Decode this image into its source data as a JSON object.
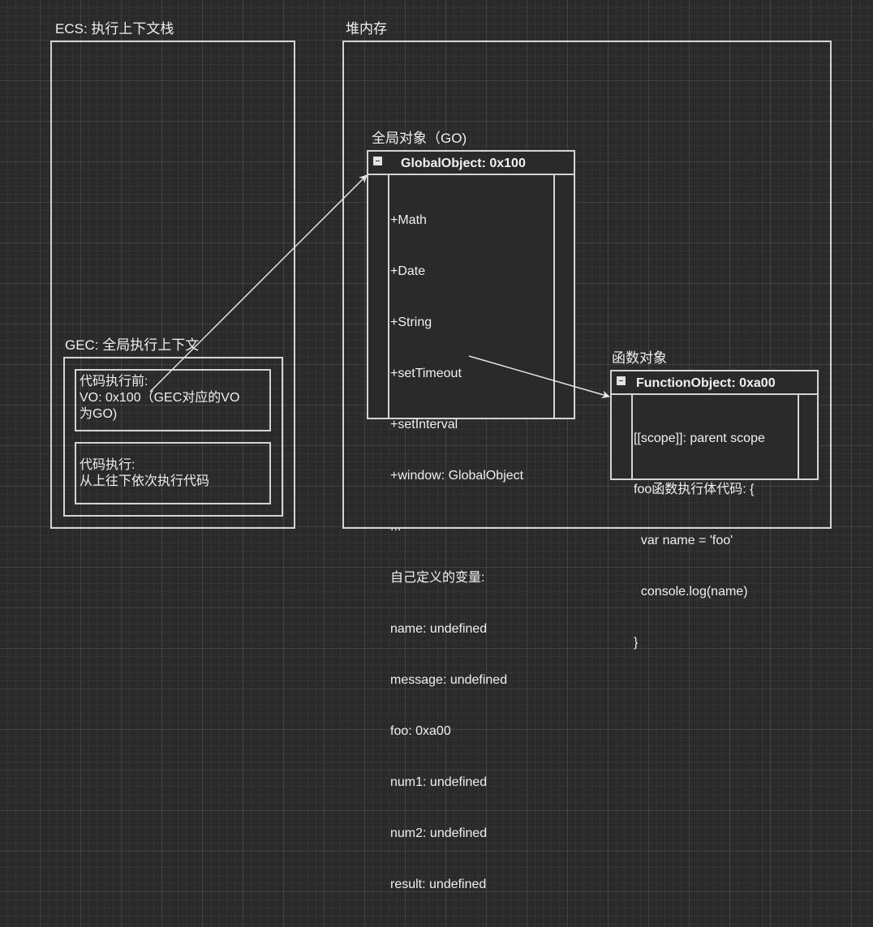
{
  "ecs": {
    "title": "ECS: 执行上下文栈",
    "gec": {
      "title": "GEC: 全局执行上下文",
      "before_exec": [
        "代码执行前:",
        "VO: 0x100（GEC对应的VO",
        "为GO)"
      ],
      "executing": [
        "代码执行:",
        "从上往下依次执行代码"
      ]
    }
  },
  "heap": {
    "title": "堆内存",
    "go": {
      "caption": "全局对象（GO)",
      "class_name": "GlobalObject: 0x100",
      "members": [
        "+Math",
        "+Date",
        "+String",
        "+setTimeout",
        "+setInterval",
        "+window: GlobalObject",
        "...",
        "自己定义的变量:",
        "name: undefined",
        "message: undefined",
        "foo: 0xa00",
        "num1: undefined",
        "num2: undefined",
        "result: undefined"
      ]
    },
    "fo": {
      "caption": "函数对象",
      "class_name": "FunctionObject: 0xa00",
      "members": [
        "[[scope]]: parent scope",
        "foo函数执行体代码: {",
        "  var name = 'foo'",
        "  console.log(name)",
        "}"
      ]
    }
  },
  "colors": {
    "background": "#2a2a2a",
    "line": "#d4d4d4",
    "text": "#f0f0f0"
  }
}
